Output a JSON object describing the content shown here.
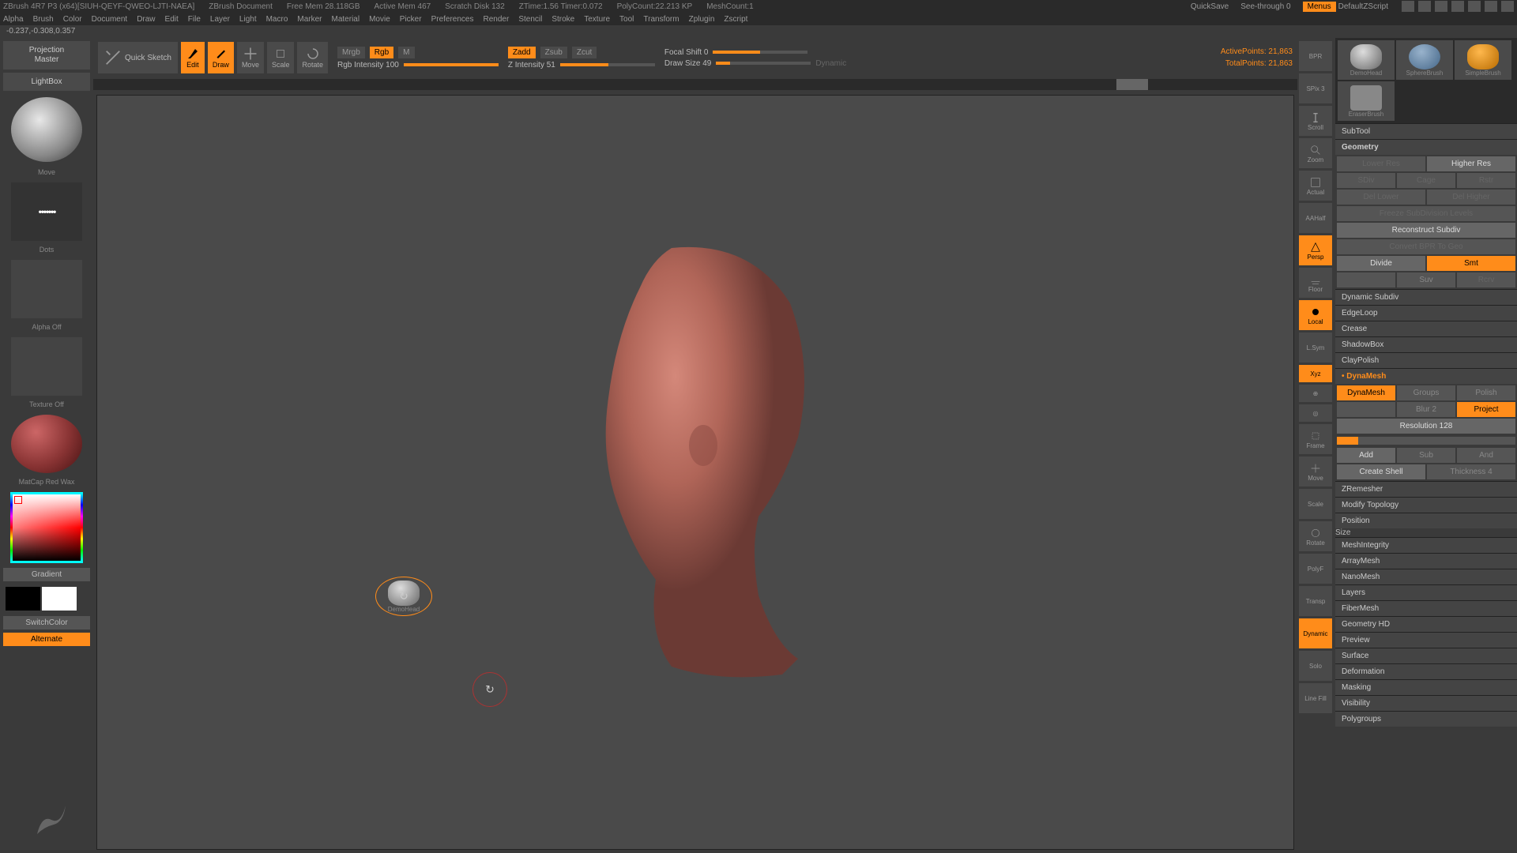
{
  "title": {
    "app": "ZBrush 4R7 P3 (x64)[SIUH-QEYF-QWEO-LJTI-NAEA]",
    "doc": "ZBrush Document",
    "freemem": "Free Mem 28.118GB",
    "activemem": "Active Mem 467",
    "scratch": "Scratch Disk 132",
    "ztime": "ZTime:1.56 Timer:0.072",
    "poly": "PolyCount:22.213 KP",
    "mesh": "MeshCount:1",
    "quicksave": "QuickSave",
    "seethrough": "See-through  0",
    "menus": "Menus",
    "script": "DefaultZScript"
  },
  "menu": [
    "Alpha",
    "Brush",
    "Color",
    "Document",
    "Draw",
    "Edit",
    "File",
    "Layer",
    "Light",
    "Macro",
    "Marker",
    "Material",
    "Movie",
    "Picker",
    "Preferences",
    "Render",
    "Stencil",
    "Stroke",
    "Texture",
    "Tool",
    "Transform",
    "Zplugin",
    "Zscript"
  ],
  "coords": "-0.237,-0.308,0.357",
  "left": {
    "pm1": "Projection",
    "pm2": "Master",
    "lightbox": "LightBox",
    "quicksketch": "Quick Sketch",
    "move": "Move",
    "dots": "Dots",
    "alpha": "Alpha Off",
    "texture": "Texture Off",
    "matcap": "MatCap Red Wax",
    "gradient": "Gradient",
    "switch": "SwitchColor",
    "alternate": "Alternate"
  },
  "tb": {
    "edit": "Edit",
    "draw": "Draw",
    "move": "Move",
    "scale": "Scale",
    "rotate": "Rotate",
    "mrgb": "Mrgb",
    "rgb": "Rgb",
    "m": "M",
    "rgbi": "Rgb Intensity 100",
    "zadd": "Zadd",
    "zsub": "Zsub",
    "zcut": "Zcut",
    "zi": "Z Intensity 51",
    "focal": "Focal Shift 0",
    "draws": "Draw Size 49",
    "dyn": "Dynamic",
    "ap": "ActivePoints:",
    "apv": "21,863",
    "tp": "TotalPoints:",
    "tpv": "21,863"
  },
  "rnav": {
    "spix": "SPix 3",
    "scroll": "Scroll",
    "zoom": "Zoom",
    "actual": "Actual",
    "aahalf": "AAHalf",
    "persp": "Persp",
    "floor": "Floor",
    "local": "Local",
    "lsym": "L.Sym",
    "xyz": "Xyz",
    "frame": "Frame",
    "move": "Move",
    "scale": "Scale",
    "rotate": "Rotate",
    "polyf": "PolyF",
    "transp": "Transp",
    "solo": "Solo",
    "dynamic": "Dynamic",
    "linefill": "Line Fill",
    "bpr": "BPR"
  },
  "tools": {
    "demohead": "DemoHead",
    "spherebrush": "SphereBrush",
    "simplebrush": "SimpleBrush",
    "eraserbrush": "EraserBrush"
  },
  "geo": {
    "subtool": "SubTool",
    "geometry": "Geometry",
    "lowerres": "Lower Res",
    "higherres": "Higher Res",
    "sdiv": "SDiv",
    "cage": "Cage",
    "rsrt": "Rstr",
    "dellower": "Del Lower",
    "delhigher": "Del Higher",
    "freeze": "Freeze SubDivision Levels",
    "reconstruct": "Reconstruct Subdiv",
    "convert": "Convert BPR To Geo",
    "divide": "Divide",
    "smt": "Smt",
    "suv": "Suv",
    "rcrv": "Rcrv",
    "dynsubdiv": "Dynamic Subdiv",
    "edgeloop": "EdgeLoop",
    "crease": "Crease",
    "shadowbox": "ShadowBox",
    "claypolish": "ClayPolish",
    "dynamesh": "DynaMesh",
    "dynameshbtn": "DynaMesh",
    "groups": "Groups",
    "polish": "Polish",
    "blur": "Blur 2",
    "project": "Project",
    "resolution": "Resolution 128",
    "add": "Add",
    "sub": "Sub",
    "and": "And",
    "createshell": "Create Shell",
    "thickness": "Thickness 4",
    "zremesher": "ZRemesher",
    "modtopo": "Modify Topology",
    "position": "Position",
    "size": "Size",
    "meshint": "MeshIntegrity",
    "arraymesh": "ArrayMesh",
    "nanomesh": "NanoMesh",
    "layers": "Layers",
    "fibermesh": "FiberMesh",
    "geohd": "Geometry HD",
    "preview": "Preview",
    "surface": "Surface",
    "deformation": "Deformation",
    "masking": "Masking",
    "visibility": "Visibility",
    "polygroups": "Polygroups"
  },
  "chart_data": null
}
